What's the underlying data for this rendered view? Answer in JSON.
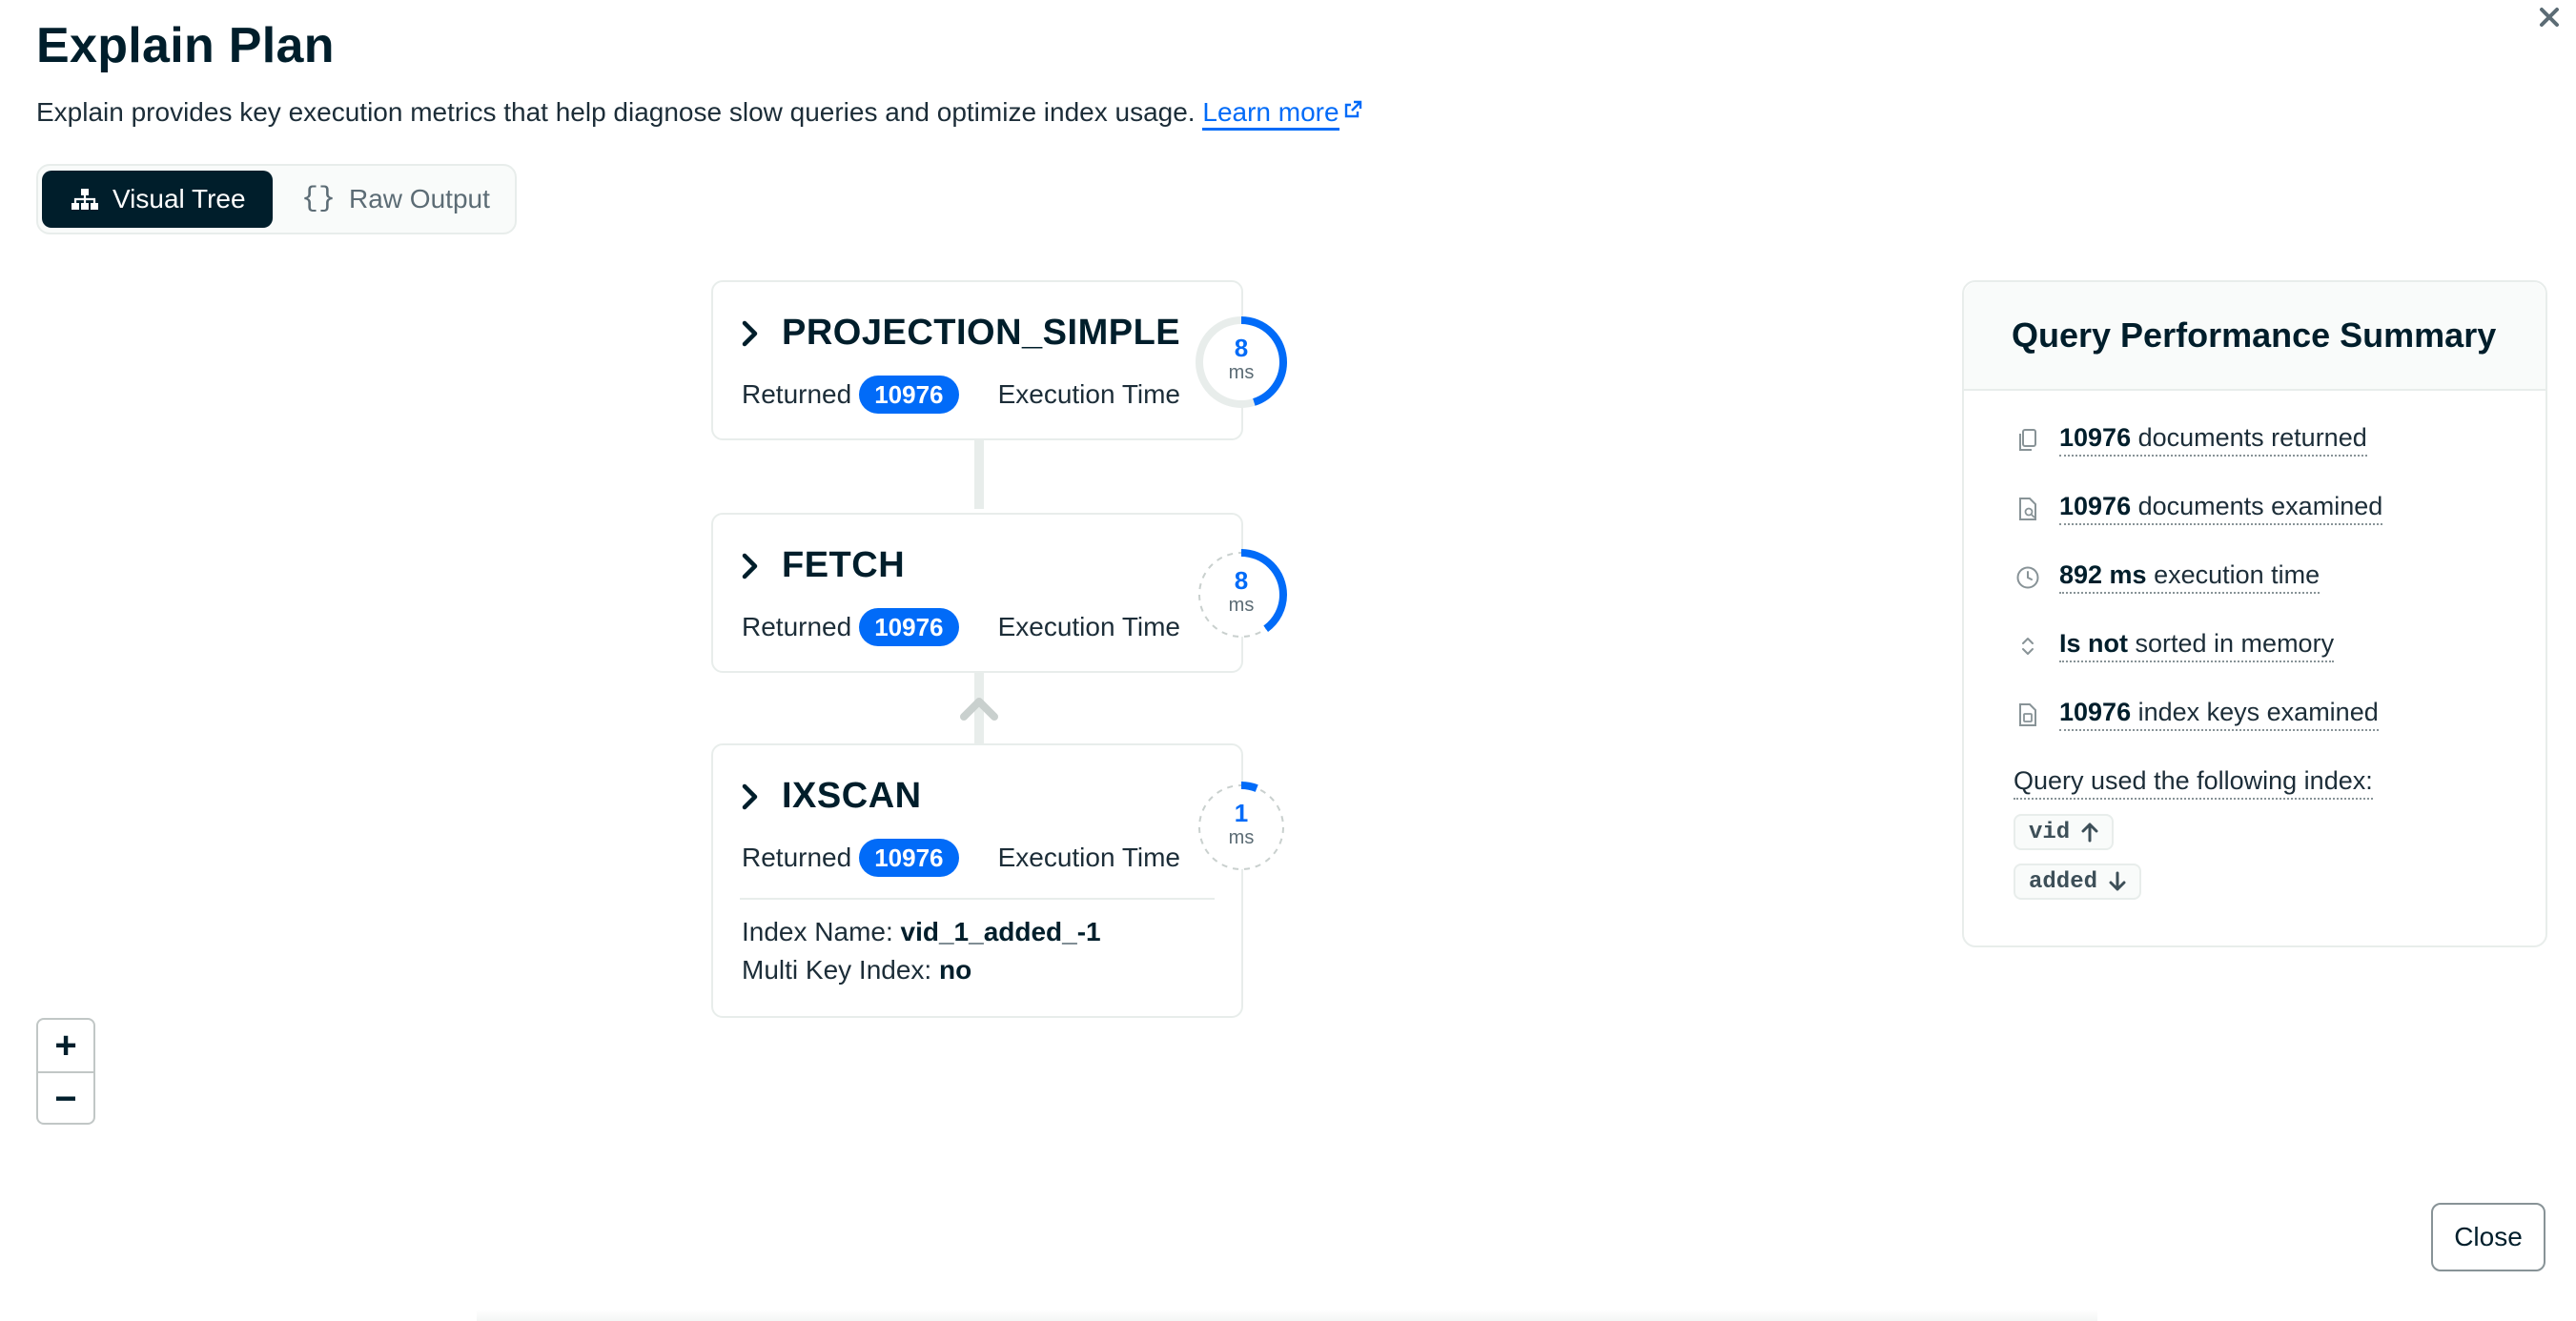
{
  "header": {
    "title": "Explain Plan",
    "description": "Explain provides key execution metrics that help diagnose slow queries and optimize index usage.",
    "learn_more": "Learn more"
  },
  "view_toggle": {
    "visual_tree": "Visual Tree",
    "raw_output": "Raw Output",
    "selected": "Visual Tree"
  },
  "stages": [
    {
      "name": "PROJECTION_SIMPLE",
      "returned_label": "Returned",
      "returned": "10976",
      "exec_label": "Execution Time",
      "exec_ms": "8",
      "unit": "ms",
      "gauge_fraction": 0.45
    },
    {
      "name": "FETCH",
      "returned_label": "Returned",
      "returned": "10976",
      "exec_label": "Execution Time",
      "exec_ms": "8",
      "unit": "ms",
      "gauge_fraction": 0.4
    },
    {
      "name": "IXSCAN",
      "returned_label": "Returned",
      "returned": "10976",
      "exec_label": "Execution Time",
      "exec_ms": "1",
      "unit": "ms",
      "gauge_fraction": 0.06,
      "index_name_label": "Index Name:",
      "index_name": "vid_1_added_-1",
      "multikey_label": "Multi Key Index:",
      "multikey": "no"
    }
  ],
  "summary": {
    "title": "Query Performance Summary",
    "docs_returned_value": "10976",
    "docs_returned_text": " documents returned",
    "docs_examined_value": "10976",
    "docs_examined_text": " documents examined",
    "exec_time_value": "892 ms",
    "exec_time_text": " execution time",
    "sorted_value": "Is not",
    "sorted_text": " sorted in memory",
    "keys_examined_value": "10976",
    "keys_examined_text": " index keys examined",
    "index_label": "Query used the following index:",
    "index_fields": [
      {
        "field": "vid",
        "direction": "up"
      },
      {
        "field": "added",
        "direction": "down"
      }
    ]
  },
  "zoom": {
    "in": "+",
    "out": "−"
  },
  "footer": {
    "close": "Close"
  },
  "colors": {
    "accent": "#016bf8",
    "dark": "#001e2b",
    "border": "#e8edeb"
  }
}
